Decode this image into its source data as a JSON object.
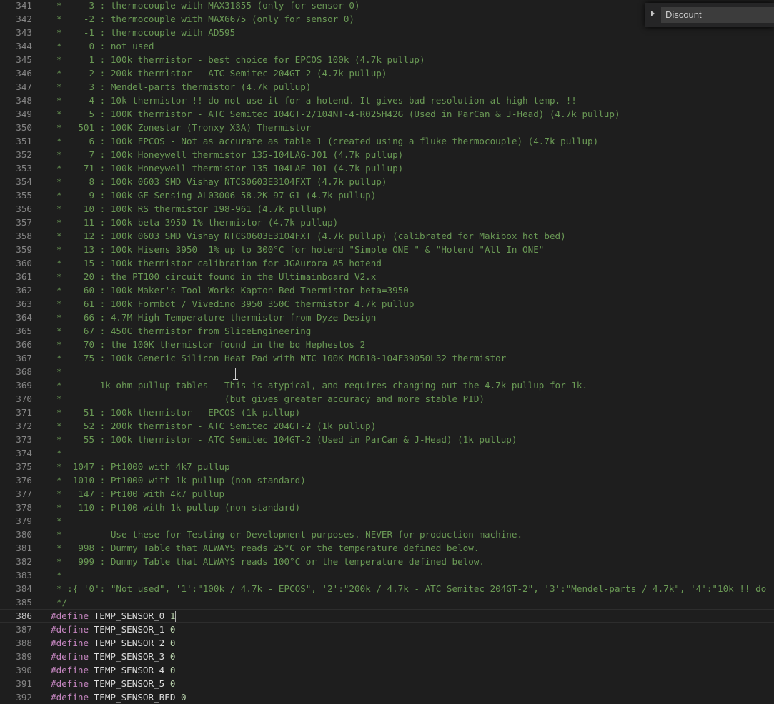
{
  "find_widget": {
    "value": "Discount"
  },
  "current_line": 386,
  "comment_lines": [
    {
      "n": "341",
      "text": "*    -3 : thermocouple with MAX31855 (only for sensor 0)"
    },
    {
      "n": "342",
      "text": "*    -2 : thermocouple with MAX6675 (only for sensor 0)"
    },
    {
      "n": "343",
      "text": "*    -1 : thermocouple with AD595"
    },
    {
      "n": "344",
      "text": "*     0 : not used"
    },
    {
      "n": "345",
      "text": "*     1 : 100k thermistor - best choice for EPCOS 100k (4.7k pullup)"
    },
    {
      "n": "346",
      "text": "*     2 : 200k thermistor - ATC Semitec 204GT-2 (4.7k pullup)"
    },
    {
      "n": "347",
      "text": "*     3 : Mendel-parts thermistor (4.7k pullup)"
    },
    {
      "n": "348",
      "text": "*     4 : 10k thermistor !! do not use it for a hotend. It gives bad resolution at high temp. !!"
    },
    {
      "n": "349",
      "text": "*     5 : 100K thermistor - ATC Semitec 104GT-2/104NT-4-R025H42G (Used in ParCan & J-Head) (4.7k pullup)"
    },
    {
      "n": "350",
      "text": "*   501 : 100K Zonestar (Tronxy X3A) Thermistor"
    },
    {
      "n": "351",
      "text": "*     6 : 100k EPCOS - Not as accurate as table 1 (created using a fluke thermocouple) (4.7k pullup)"
    },
    {
      "n": "352",
      "text": "*     7 : 100k Honeywell thermistor 135-104LAG-J01 (4.7k pullup)"
    },
    {
      "n": "353",
      "text": "*    71 : 100k Honeywell thermistor 135-104LAF-J01 (4.7k pullup)"
    },
    {
      "n": "354",
      "text": "*     8 : 100k 0603 SMD Vishay NTCS0603E3104FXT (4.7k pullup)"
    },
    {
      "n": "355",
      "text": "*     9 : 100k GE Sensing AL03006-58.2K-97-G1 (4.7k pullup)"
    },
    {
      "n": "356",
      "text": "*    10 : 100k RS thermistor 198-961 (4.7k pullup)"
    },
    {
      "n": "357",
      "text": "*    11 : 100k beta 3950 1% thermistor (4.7k pullup)"
    },
    {
      "n": "358",
      "text": "*    12 : 100k 0603 SMD Vishay NTCS0603E3104FXT (4.7k pullup) (calibrated for Makibox hot bed)"
    },
    {
      "n": "359",
      "text": "*    13 : 100k Hisens 3950  1% up to 300°C for hotend \"Simple ONE \" & \"Hotend \"All In ONE\""
    },
    {
      "n": "360",
      "text": "*    15 : 100k thermistor calibration for JGAurora A5 hotend"
    },
    {
      "n": "361",
      "text": "*    20 : the PT100 circuit found in the Ultimainboard V2.x"
    },
    {
      "n": "362",
      "text": "*    60 : 100k Maker's Tool Works Kapton Bed Thermistor beta=3950"
    },
    {
      "n": "363",
      "text": "*    61 : 100k Formbot / Vivedino 3950 350C thermistor 4.7k pullup"
    },
    {
      "n": "364",
      "text": "*    66 : 4.7M High Temperature thermistor from Dyze Design"
    },
    {
      "n": "365",
      "text": "*    67 : 450C thermistor from SliceEngineering"
    },
    {
      "n": "366",
      "text": "*    70 : the 100K thermistor found in the bq Hephestos 2"
    },
    {
      "n": "367",
      "text": "*    75 : 100k Generic Silicon Heat Pad with NTC 100K MGB18-104F39050L32 thermistor"
    },
    {
      "n": "368",
      "text": "*"
    },
    {
      "n": "369",
      "text": "*       1k ohm pullup tables - This is atypical, and requires changing out the 4.7k pullup for 1k."
    },
    {
      "n": "370",
      "text": "*                              (but gives greater accuracy and more stable PID)"
    },
    {
      "n": "371",
      "text": "*    51 : 100k thermistor - EPCOS (1k pullup)"
    },
    {
      "n": "372",
      "text": "*    52 : 200k thermistor - ATC Semitec 204GT-2 (1k pullup)"
    },
    {
      "n": "373",
      "text": "*    55 : 100k thermistor - ATC Semitec 104GT-2 (Used in ParCan & J-Head) (1k pullup)"
    },
    {
      "n": "374",
      "text": "*"
    },
    {
      "n": "375",
      "text": "*  1047 : Pt1000 with 4k7 pullup"
    },
    {
      "n": "376",
      "text": "*  1010 : Pt1000 with 1k pullup (non standard)"
    },
    {
      "n": "377",
      "text": "*   147 : Pt100 with 4k7 pullup"
    },
    {
      "n": "378",
      "text": "*   110 : Pt100 with 1k pullup (non standard)"
    },
    {
      "n": "379",
      "text": "*"
    },
    {
      "n": "380",
      "text": "*         Use these for Testing or Development purposes. NEVER for production machine."
    },
    {
      "n": "381",
      "text": "*   998 : Dummy Table that ALWAYS reads 25°C or the temperature defined below."
    },
    {
      "n": "382",
      "text": "*   999 : Dummy Table that ALWAYS reads 100°C or the temperature defined below."
    },
    {
      "n": "383",
      "text": "*"
    },
    {
      "n": "384",
      "text": "* :{ '0': \"Not used\", '1':\"100k / 4.7k - EPCOS\", '2':\"200k / 4.7k - ATC Semitec 204GT-2\", '3':\"Mendel-parts / 4.7k\", '4':\"10k !! do"
    },
    {
      "n": "385",
      "text": "*/"
    }
  ],
  "define_lines": [
    {
      "n": "386",
      "directive": "#define",
      "name": "TEMP_SENSOR_0",
      "value": "1"
    },
    {
      "n": "387",
      "directive": "#define",
      "name": "TEMP_SENSOR_1",
      "value": "0"
    },
    {
      "n": "388",
      "directive": "#define",
      "name": "TEMP_SENSOR_2",
      "value": "0"
    },
    {
      "n": "389",
      "directive": "#define",
      "name": "TEMP_SENSOR_3",
      "value": "0"
    },
    {
      "n": "390",
      "directive": "#define",
      "name": "TEMP_SENSOR_4",
      "value": "0"
    },
    {
      "n": "391",
      "directive": "#define",
      "name": "TEMP_SENSOR_5",
      "value": "0"
    },
    {
      "n": "392",
      "directive": "#define",
      "name": "TEMP_SENSOR_BED",
      "value": "0"
    }
  ],
  "colors": {
    "background": "#1e1e1e",
    "comment": "#6a9955",
    "keyword": "#c586c0",
    "line_number": "#858585"
  }
}
